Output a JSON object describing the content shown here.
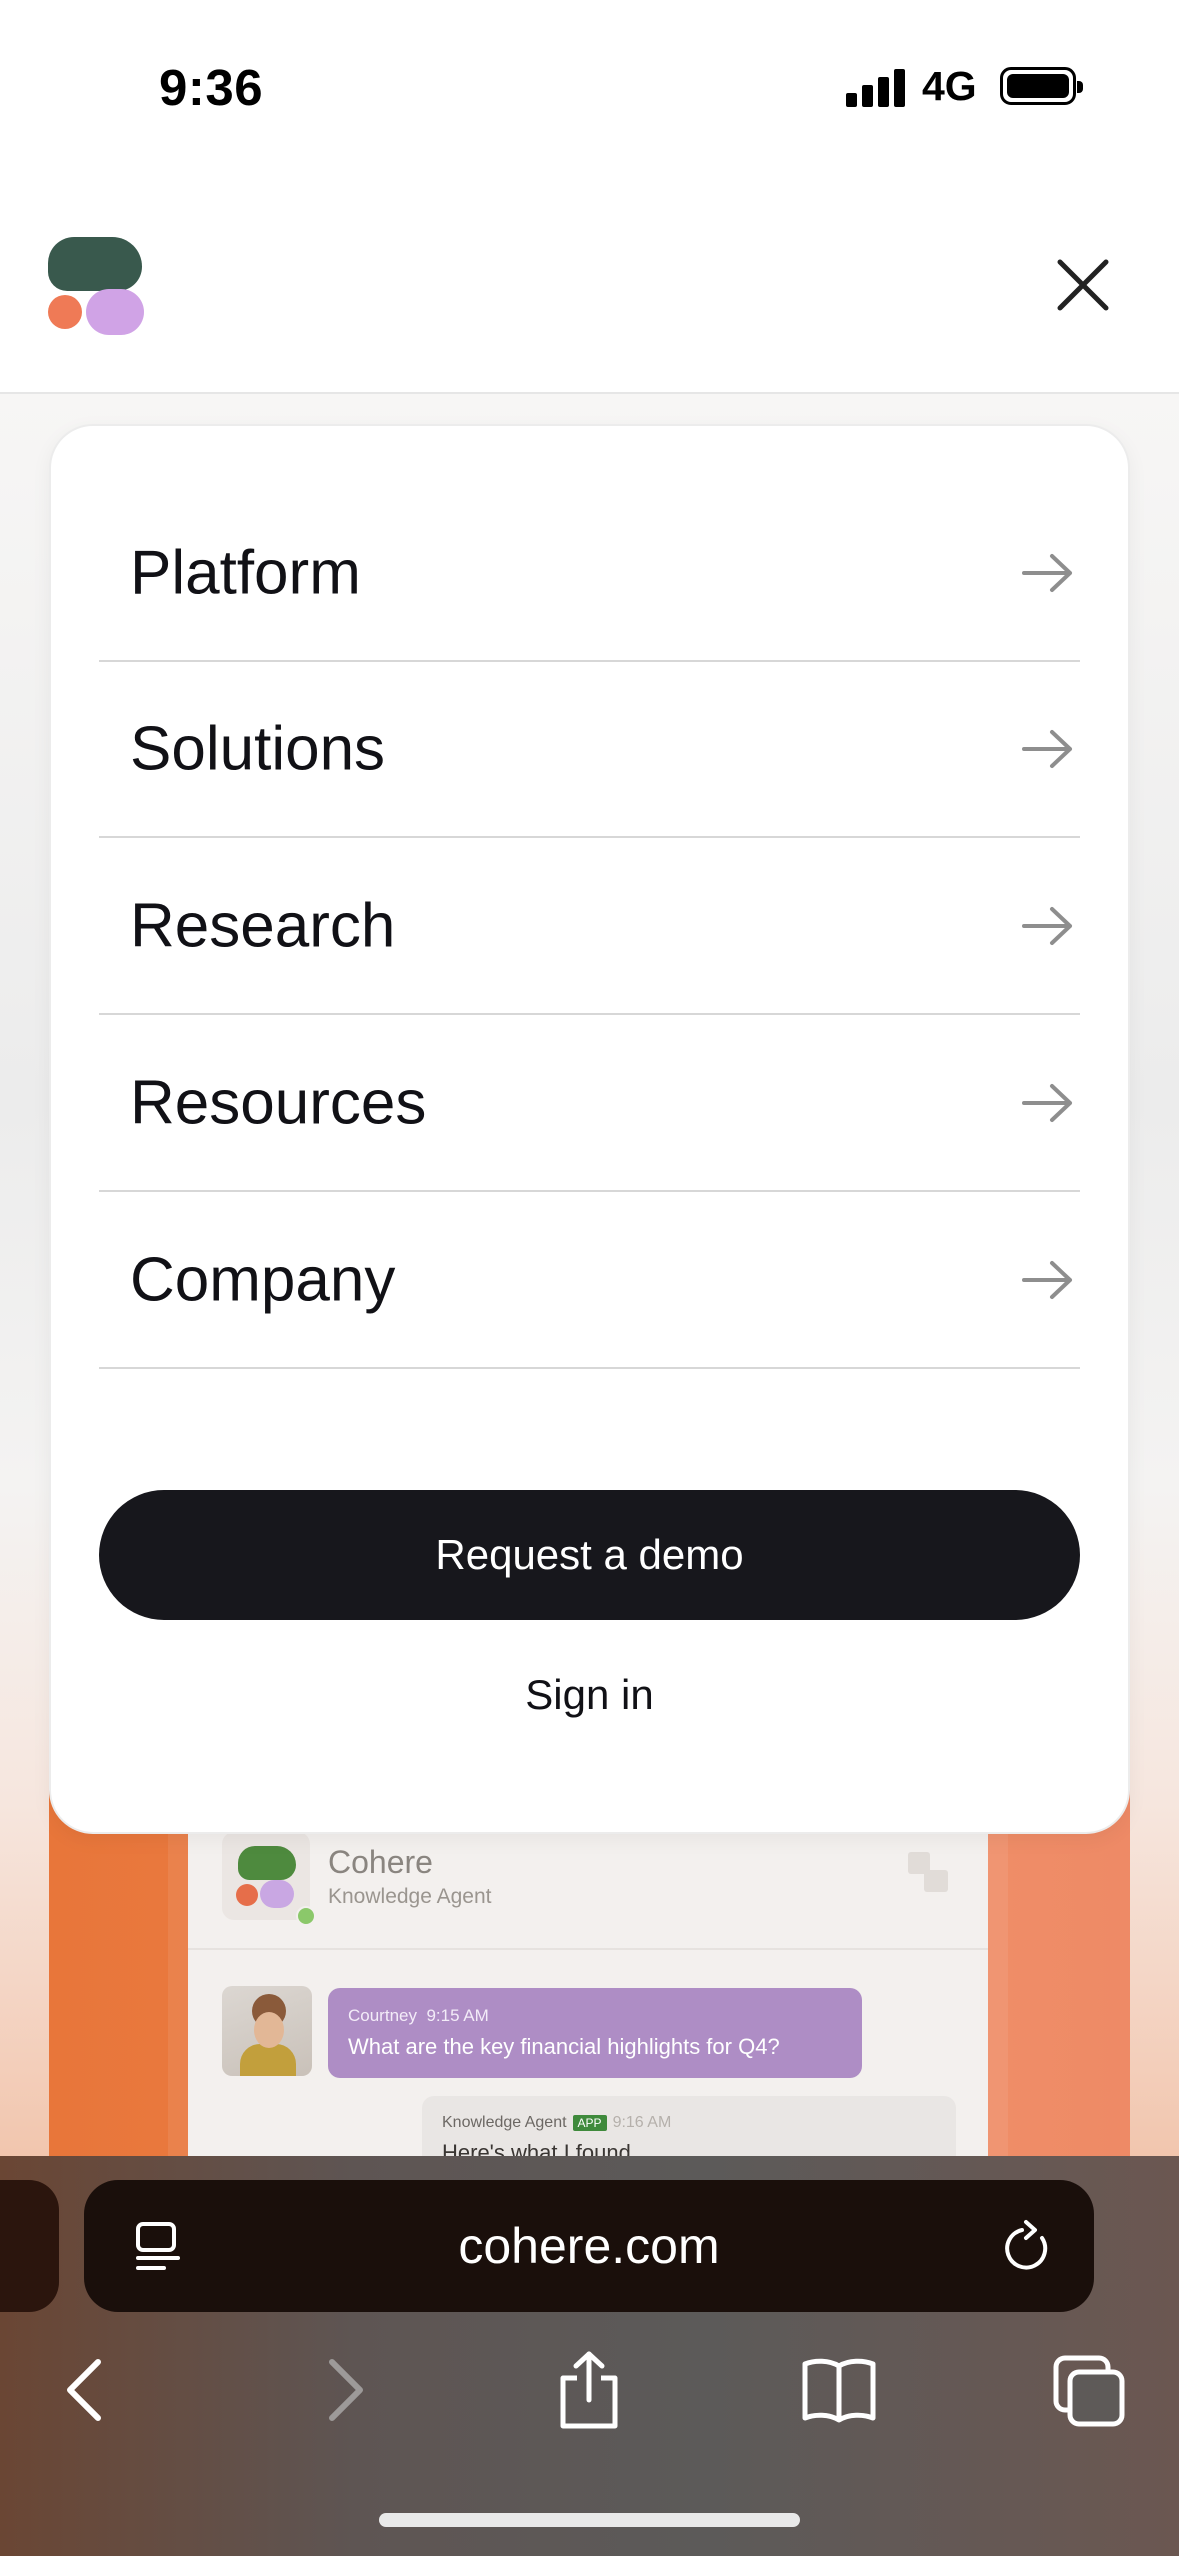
{
  "status_bar": {
    "time": "9:36",
    "network": "4G"
  },
  "header": {
    "logo": "cohere-logo",
    "close_icon": "close-icon"
  },
  "menu": {
    "items": [
      {
        "label": "Platform"
      },
      {
        "label": "Solutions"
      },
      {
        "label": "Research"
      },
      {
        "label": "Resources"
      },
      {
        "label": "Company"
      }
    ],
    "demo_button": "Request a demo",
    "signin_link": "Sign in"
  },
  "background_page": {
    "agent_name": "Cohere",
    "agent_role": "Knowledge Agent",
    "user_message": {
      "author": "Courtney",
      "time": "9:15 AM",
      "text": "What are the key financial highlights for Q4?"
    },
    "agent_reply": {
      "author": "Knowledge Agent",
      "badge": "APP",
      "time": "9:16 AM",
      "text": "Here's what I found"
    }
  },
  "browser": {
    "url": "cohere.com",
    "icons": [
      "reader-icon",
      "reload-icon",
      "back-icon",
      "forward-icon",
      "share-icon",
      "bookmarks-icon",
      "tabs-icon"
    ]
  },
  "colors": {
    "accent_dark": "#17171c",
    "logo_green": "#39594d",
    "logo_coral": "#ef7a56",
    "logo_lilac": "#d0a3e6",
    "hero_orange": "#e8763a"
  }
}
